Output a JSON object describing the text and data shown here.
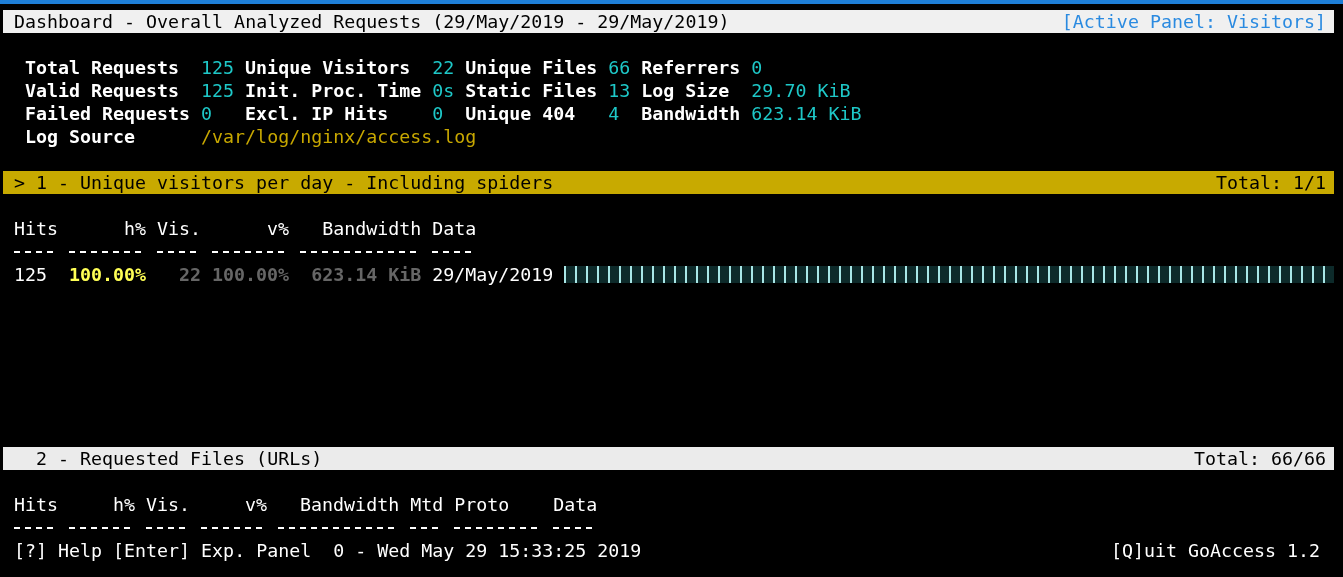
{
  "header": {
    "title": "Dashboard - Overall Analyzed Requests (29/May/2019 - 29/May/2019)",
    "active_panel": "[Active Panel: Visitors]"
  },
  "stats": [
    [
      {
        "label": "Total Requests",
        "value": "125"
      },
      {
        "label": "Unique Visitors",
        "value": "22"
      },
      {
        "label": "Unique Files",
        "value": "66"
      },
      {
        "label": "Referrers",
        "value": "0"
      }
    ],
    [
      {
        "label": "Valid Requests",
        "value": "125"
      },
      {
        "label": "Init. Proc. Time",
        "value": "0s"
      },
      {
        "label": "Static Files",
        "value": "13"
      },
      {
        "label": "Log Size",
        "value": "29.70 KiB"
      }
    ],
    [
      {
        "label": "Failed Requests",
        "value": "0"
      },
      {
        "label": "Excl. IP Hits",
        "value": "0"
      },
      {
        "label": "Unique 404",
        "value": "4"
      },
      {
        "label": "Bandwidth",
        "value": "623.14 KiB"
      }
    ]
  ],
  "log_source": {
    "label": "Log Source",
    "value": "/var/log/nginx/access.log"
  },
  "panels": [
    {
      "kind": "visitors",
      "selected": true,
      "marker": ">",
      "title": "1 - Unique visitors per day - Including spiders",
      "total": "Total: 1/1",
      "columns": [
        "Hits",
        "h%",
        "Vis.",
        "v%",
        "Bandwidth",
        "Data"
      ],
      "rows": [
        {
          "cells": [
            "125",
            "100.00%",
            "22",
            "100.00%",
            "623.14 KiB",
            "29/May/2019"
          ],
          "level": 1
        }
      ]
    },
    {
      "kind": "requests",
      "selected": false,
      "title": "2 - Requested Files (URLs)",
      "total": "Total: 66/66",
      "columns": [
        "Hits",
        "h%",
        "Vis.",
        "v%",
        "Bandwidth",
        "Mtd",
        "Proto",
        "Data"
      ]
    }
  ],
  "status_bar": {
    "hints": [
      "[?] Help",
      "[Enter] Exp. Panel"
    ],
    "info": "0 - Wed May 29 15:33:25 2019",
    "quit": "[Q]uit GoAccess 1.2"
  }
}
